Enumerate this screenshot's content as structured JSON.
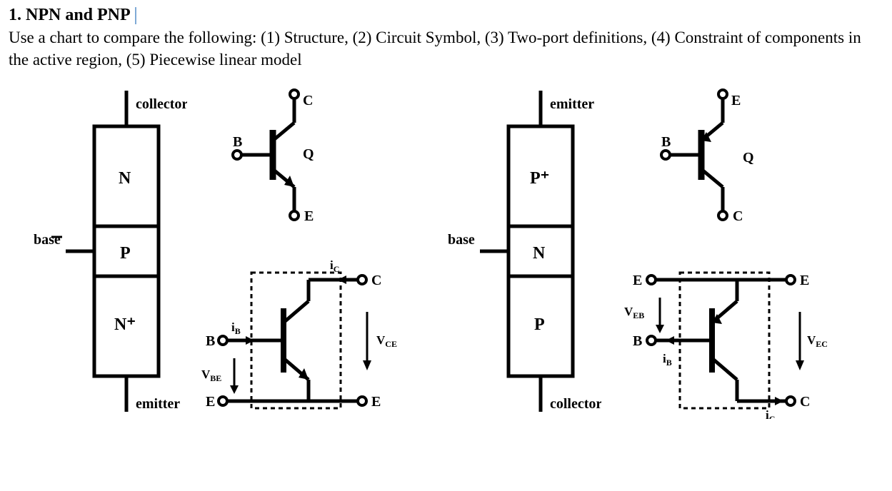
{
  "title": "1. NPN and PNP",
  "instructions": "Use a chart to compare the following: (1) Structure, (2) Circuit Symbol, (3) Two-port definitions, (4) Constraint of components in the active region, (5) Piecewise linear model",
  "npn": {
    "structure": {
      "top_terminal": "collector",
      "bottom_terminal": "emitter",
      "side_terminal": "base",
      "layer1": "N",
      "layer2": "P",
      "layer3": "N⁺"
    },
    "symbol": {
      "Q": "Q",
      "C": "C",
      "B": "B",
      "E": "E"
    },
    "twoport": {
      "iB": "iB",
      "iC": "iC",
      "vBE": "VBE",
      "vCE": "VCE",
      "B": "B",
      "E": "E",
      "C": "C"
    }
  },
  "pnp": {
    "structure": {
      "top_terminal": "emitter",
      "bottom_terminal": "collector",
      "side_terminal": "base",
      "layer1": "P⁺",
      "layer2": "N",
      "layer3": "P"
    },
    "symbol": {
      "Q": "Q",
      "C": "C",
      "B": "B",
      "E": "E"
    },
    "twoport": {
      "iB": "iB",
      "iC": "iC",
      "vEB": "VEB",
      "vEC": "VEC",
      "B": "B",
      "E": "E",
      "C": "C"
    }
  }
}
